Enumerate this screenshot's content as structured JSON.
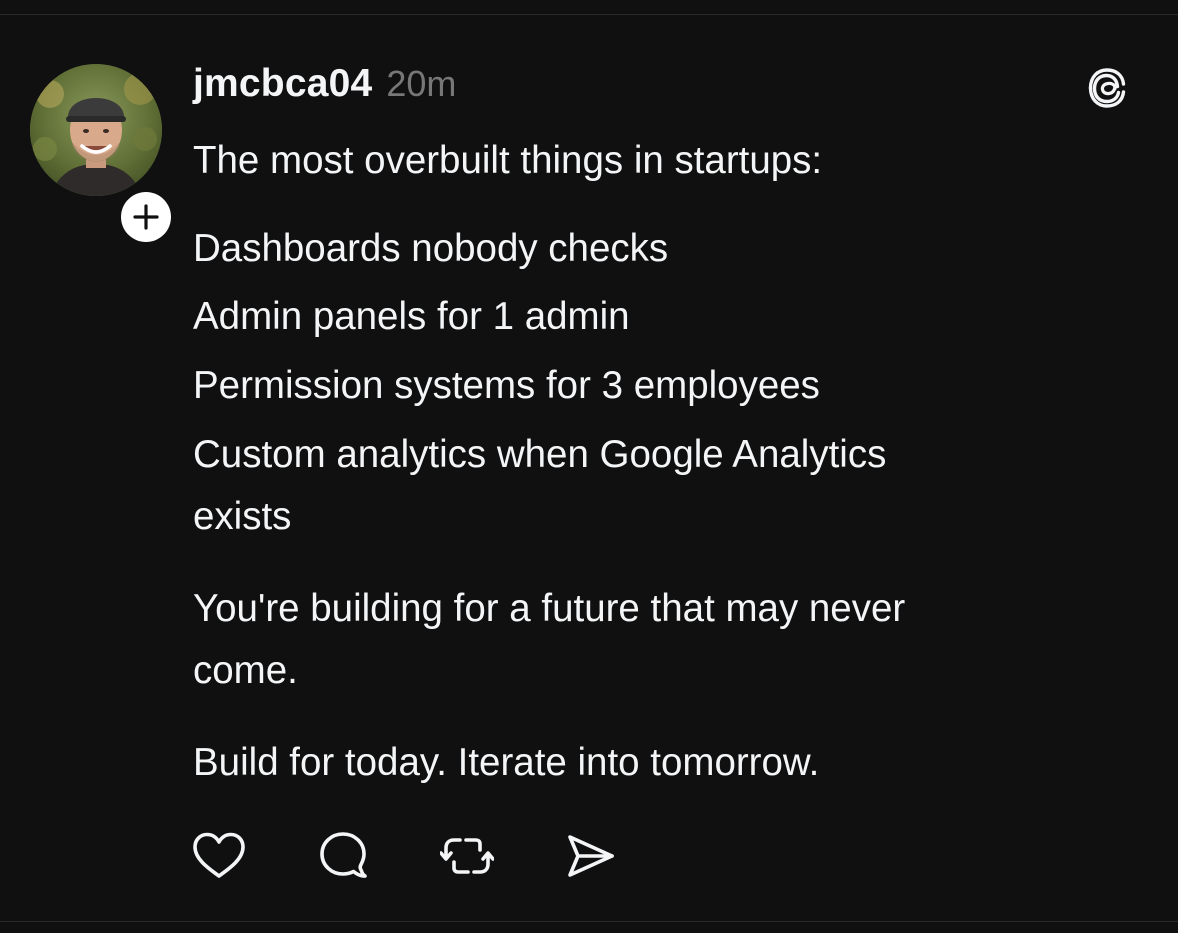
{
  "post": {
    "username": "jmcbca04",
    "timestamp": "20m",
    "lines": {
      "l1": "The most overbuilt things in startups:",
      "l2": "Dashboards nobody checks",
      "l3": "Admin panels for 1 admin",
      "l4": "Permission systems for 3 employees",
      "l5": "Custom analytics when Google Analytics",
      "l6": "exists",
      "l7": "You're building for a future that may never",
      "l8": "come.",
      "l9": "Build for today. Iterate into tomorrow."
    }
  },
  "icons": {
    "follow": "plus-icon",
    "brand": "threads-logo-icon",
    "like": "heart-icon",
    "reply": "comment-icon",
    "repost": "repost-icon",
    "share": "send-icon"
  },
  "colors": {
    "background": "#101010",
    "text": "#f3f5f7",
    "muted": "#777777"
  }
}
